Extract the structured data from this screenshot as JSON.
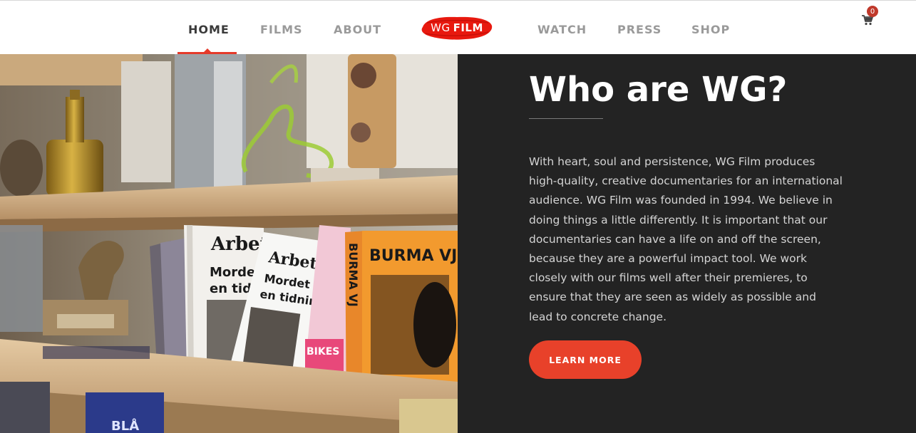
{
  "nav": {
    "items": [
      {
        "label": "HOME",
        "active": true
      },
      {
        "label": "FILMS",
        "active": false
      },
      {
        "label": "ABOUT",
        "active": false
      },
      {
        "label": "WATCH",
        "active": false
      },
      {
        "label": "PRESS",
        "active": false
      },
      {
        "label": "SHOP",
        "active": false
      }
    ]
  },
  "logo": {
    "part1": "WG",
    "part2": "FILM"
  },
  "cart": {
    "count": "0",
    "icon": "cart-icon"
  },
  "hero": {
    "title": "Who are WG?",
    "body": "With heart, soul and persistence, WG Film produces high-quality, creative documentaries for an international audience. WG Film was founded in 1994. We believe in doing things a little differently. It is important that our documentaries can have a life on and off the screen, because they are a powerful impact tool. We work closely with our films well after their premieres, to ensure that they are seen as widely as possible and lead to concrete change.",
    "cta_label": "LEARN MORE"
  },
  "photo": {
    "dvd_labels": [
      "Arbete",
      "Morde",
      "en tid",
      "Arbete",
      "Mordet p",
      "en tidning",
      "BIKES",
      "BURMA VJ",
      "BURMA VJ",
      "BLÅ"
    ]
  },
  "colors": {
    "accent": "#e8412a",
    "dark_panel": "#232323",
    "nav_active": "#3a3a3a",
    "nav_inactive": "#9a9a9a"
  }
}
